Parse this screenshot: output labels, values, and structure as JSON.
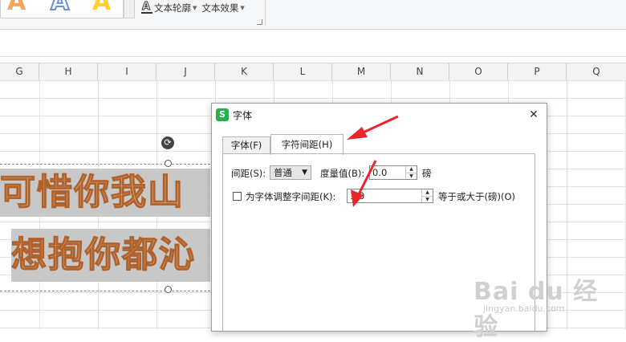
{
  "ribbon": {
    "wordart_styles": [
      "A",
      "A",
      "A"
    ],
    "text_outline_label": "文本轮廓",
    "text_effect_label": "文本效果",
    "outline_icon_glyph": "A"
  },
  "columns": [
    "G",
    "H",
    "I",
    "J",
    "K",
    "L",
    "M",
    "N",
    "O",
    "P",
    "Q"
  ],
  "wordart": {
    "line1": "可惜你我山",
    "line2": "想抱你都沁",
    "rotate_glyph": "⟳"
  },
  "dialog": {
    "title": "字体",
    "app_icon": "S",
    "close_glyph": "✕",
    "tabs": [
      {
        "label": "字体(F)",
        "active": false
      },
      {
        "label": "字符间距(H)",
        "active": true
      }
    ],
    "spacing_label": "间距(S):",
    "spacing_value": "普通",
    "measure_label": "度量值(B):",
    "measure_value": "0.0",
    "measure_unit": "磅",
    "kerning_checkbox_label": "为字体调整字间距(K):",
    "kerning_checked": false,
    "kerning_value": "1.0",
    "kerning_suffix": "等于或大于(磅)(O)"
  },
  "watermark": {
    "logo": "Bai du 经验",
    "url": "jingyan.baidu.com"
  },
  "colors": {
    "annotation_arrow": "#e8262b",
    "wordart_fill": "#e8b98a",
    "wordart_stroke": "#b0622c",
    "app_icon": "#25b24a"
  }
}
